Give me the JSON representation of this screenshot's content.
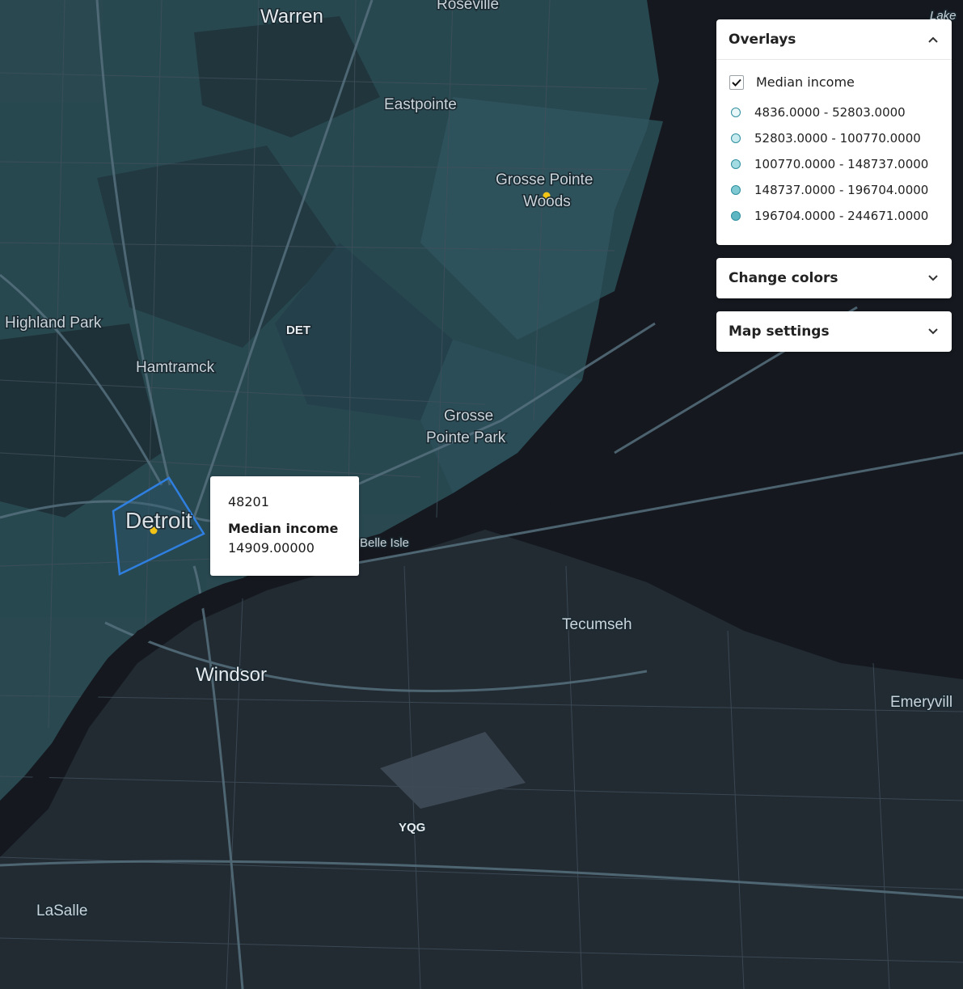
{
  "map": {
    "places": [
      {
        "id": "warren",
        "name": "Warren"
      },
      {
        "id": "roseville",
        "name": "Roseville"
      },
      {
        "id": "lake",
        "name": "Lake"
      },
      {
        "id": "eastpointe",
        "name": "Eastpointe"
      },
      {
        "id": "grosse-pointe-woods-1",
        "name": "Grosse Pointe"
      },
      {
        "id": "grosse-pointe-woods-2",
        "name": "Woods"
      },
      {
        "id": "highland-park",
        "name": "Highland Park"
      },
      {
        "id": "det",
        "name": "DET"
      },
      {
        "id": "hamtramck",
        "name": "Hamtramck"
      },
      {
        "id": "grosse-pointe-park-1",
        "name": "Grosse"
      },
      {
        "id": "grosse-pointe-park-2",
        "name": "Pointe Park"
      },
      {
        "id": "detroit",
        "name": "Detroit"
      },
      {
        "id": "belle-isle",
        "name": "Belle Isle"
      },
      {
        "id": "tecumseh",
        "name": "Tecumseh"
      },
      {
        "id": "windsor",
        "name": "Windsor"
      },
      {
        "id": "emeryville",
        "name": "Emeryvill"
      },
      {
        "id": "yqg",
        "name": "YQG"
      },
      {
        "id": "lasalle",
        "name": "LaSalle"
      }
    ],
    "colors": {
      "water": "#15191f",
      "land": "#252e36",
      "road": "#3c4a56",
      "overlay_fill": "#2b5c64",
      "selection": "#2f7fe0",
      "marker": "#f2c418"
    }
  },
  "overlays": {
    "title": "Overlays",
    "layer": {
      "label": "Median income",
      "checked": true
    },
    "legend": [
      {
        "label": "4836.0000 - 52803.0000",
        "color": "#eaf7f9"
      },
      {
        "label": "52803.0000 - 100770.0000",
        "color": "#c7ebef"
      },
      {
        "label": "100770.0000 - 148737.0000",
        "color": "#a3dbe2"
      },
      {
        "label": "148737.0000 - 196704.0000",
        "color": "#7fc9d3"
      },
      {
        "label": "196704.0000 - 244671.0000",
        "color": "#5fb6c3"
      }
    ]
  },
  "change_colors": {
    "title": "Change colors"
  },
  "map_settings": {
    "title": "Map settings"
  },
  "tooltip": {
    "id": "48201",
    "label": "Median income",
    "value": "14909.00000"
  }
}
